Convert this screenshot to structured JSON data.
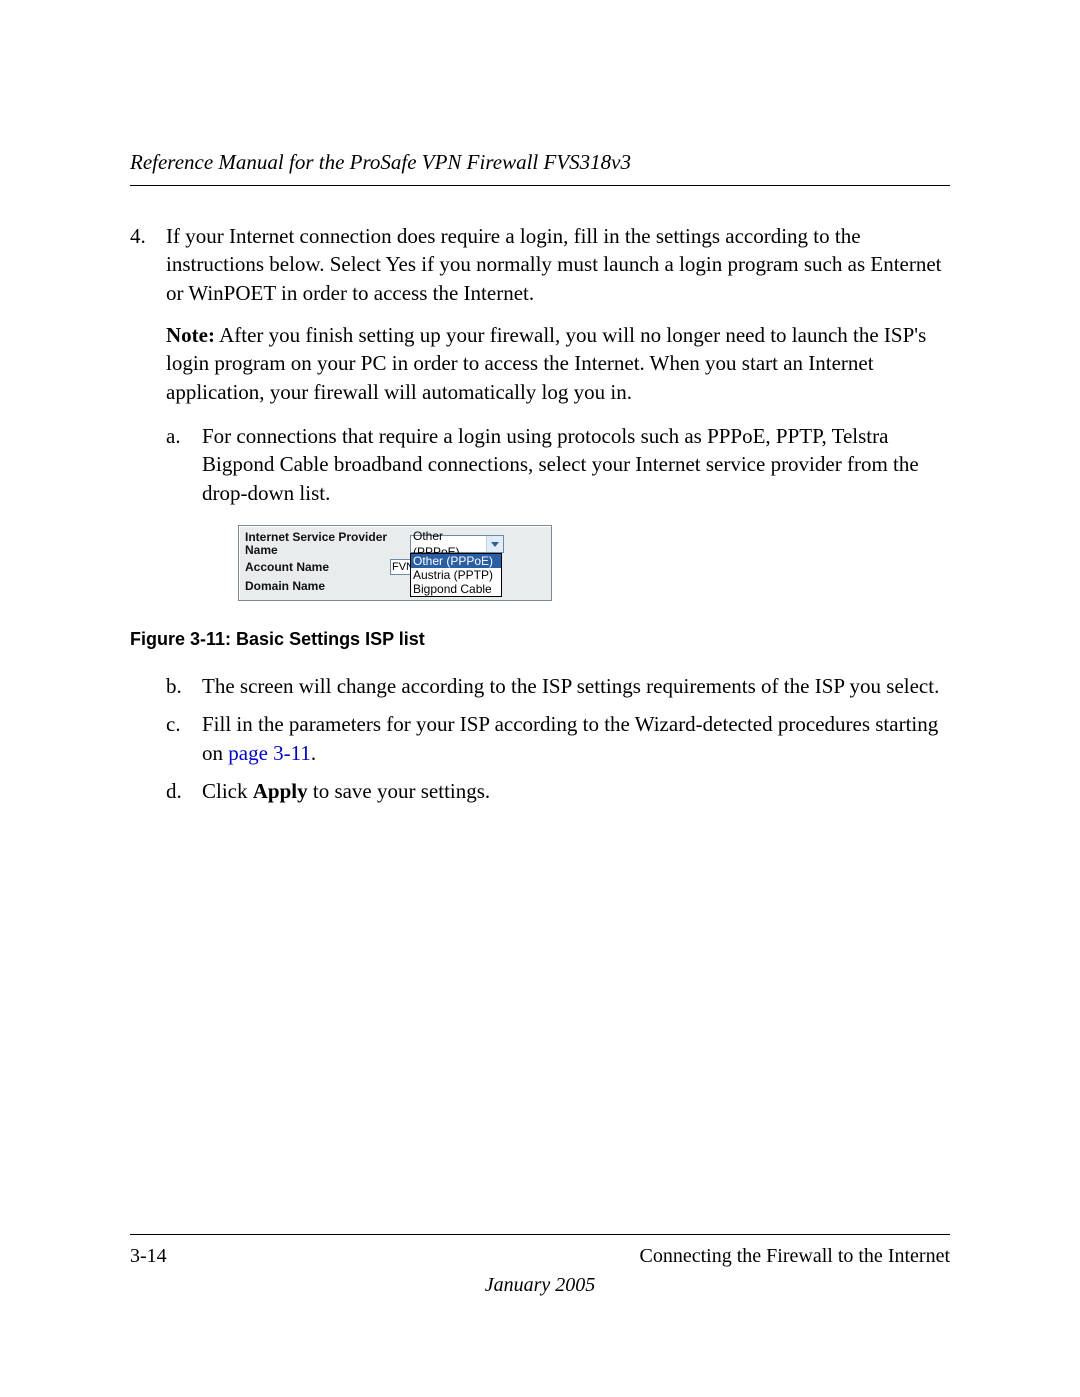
{
  "header": {
    "title": "Reference Manual for the ProSafe VPN Firewall FVS318v3"
  },
  "content": {
    "item4_num": "4.",
    "item4_text": "If your Internet connection does require a login, fill in the settings according to the instructions below. Select Yes if you normally must launch a login program such as Enternet or WinPOET in order to access the Internet.",
    "note_label": "Note:",
    "note_text": " After you finish setting up your firewall, you will no longer need to launch the ISP's login program on your PC in order to access the Internet. When you start an Internet application, your firewall will automatically log you in.",
    "sub_a_num": "a.",
    "sub_a_text": "For connections that require a login using protocols such as PPPoE, PPTP, Telstra Bigpond Cable broadband connections, select your Internet service provider from the drop-down list.",
    "figure_caption": "Figure 3-11: Basic Settings ISP list",
    "sub_b_num": "b.",
    "sub_b_text": "The screen will change according to the ISP settings requirements of the ISP you select.",
    "sub_c_num": "c.",
    "sub_c_text_pre": "Fill in the parameters for your ISP according to the Wizard-detected procedures starting on ",
    "sub_c_link": "page 3-11",
    "sub_c_text_post": ".",
    "sub_d_num": "d.",
    "sub_d_text_pre": "Click ",
    "sub_d_bold": "Apply",
    "sub_d_text_post": " to save your settings."
  },
  "ui": {
    "label_isp": "Internet Service Provider Name",
    "label_account": "Account Name",
    "label_domain": "Domain Name",
    "select_value": "Other (PPPoE)",
    "input_value": "FVN",
    "dropdown": {
      "opt1": "Other (PPPoE)",
      "opt2": "Austria (PPTP)",
      "opt3": "Bigpond Cable"
    }
  },
  "footer": {
    "page_num": "3-14",
    "chapter": "Connecting the Firewall to the Internet",
    "date": "January 2005"
  }
}
